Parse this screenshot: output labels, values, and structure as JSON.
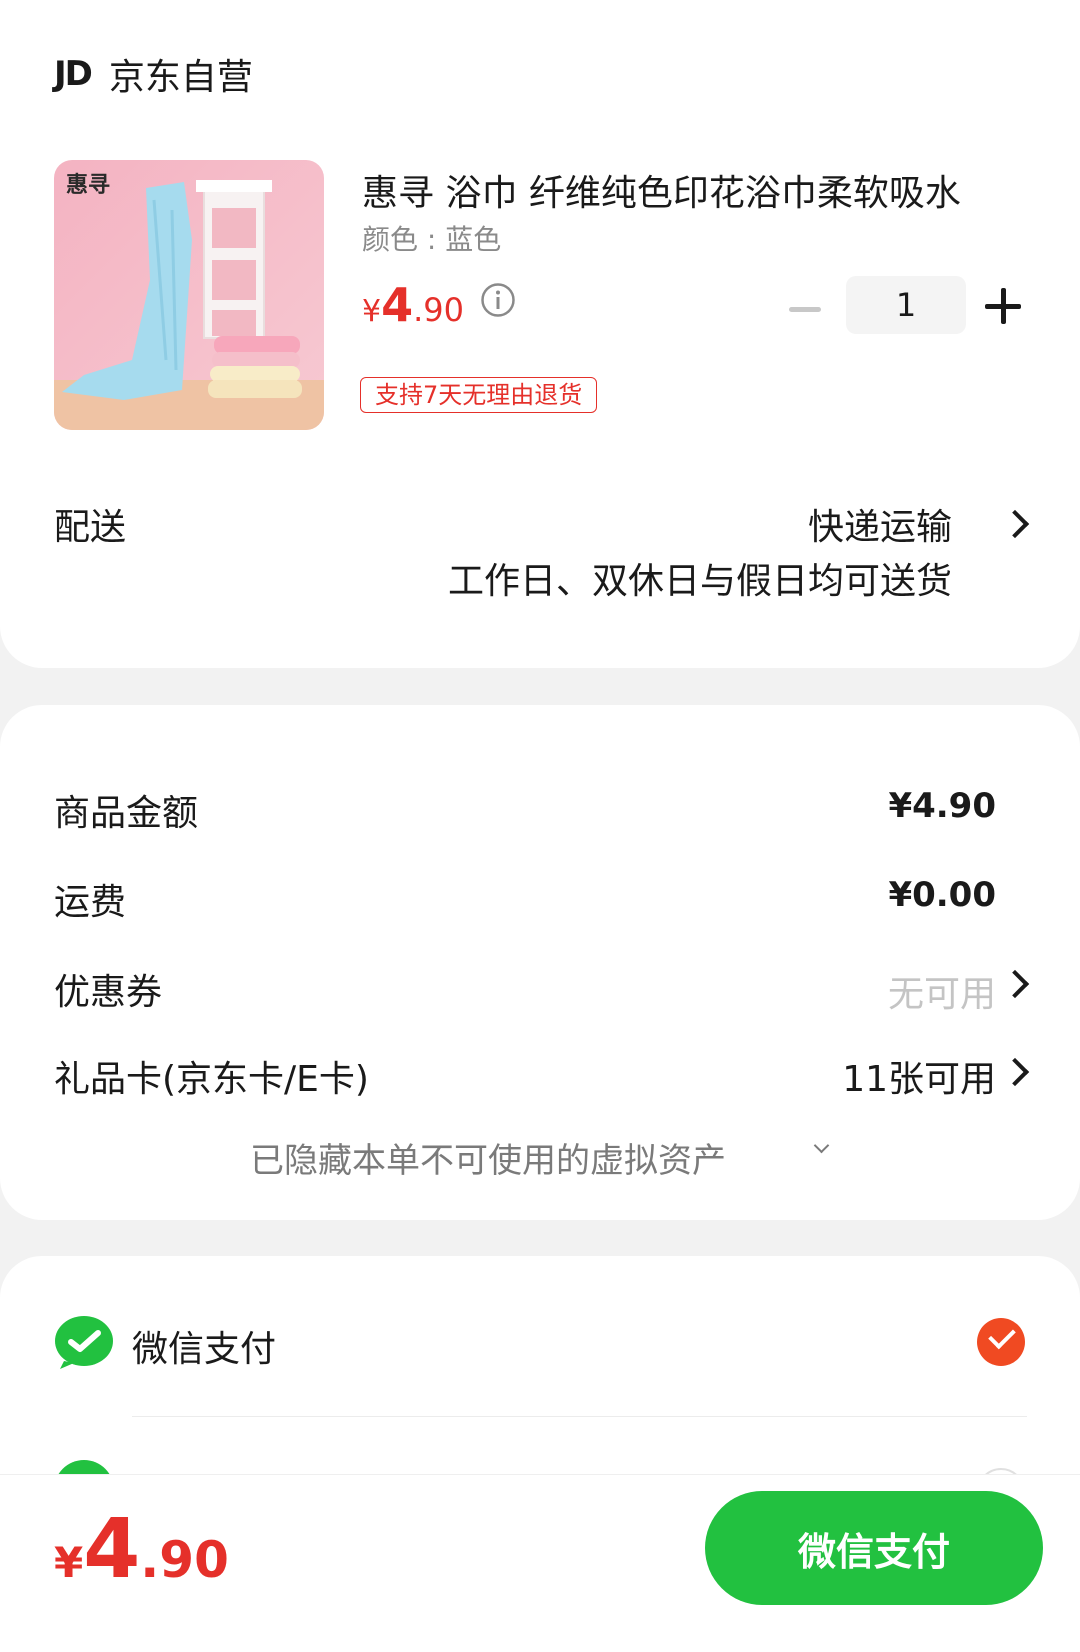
{
  "shop": {
    "logo_text": "JD",
    "name": "京东自营"
  },
  "product": {
    "image_text": "惠寻",
    "title": "惠寻 浴巾 纤维纯色印花浴巾柔软吸水",
    "spec": "颜色 : 蓝色",
    "price_symbol": "¥",
    "price_int": "4",
    "price_dec": ".90",
    "quantity": "1",
    "return_tag": "支持7天无理由退货"
  },
  "delivery": {
    "label": "配送",
    "method": "快递运输",
    "note": "工作日、双休日与假日均可送货"
  },
  "summary": {
    "goods_label": "商品金额",
    "goods_value": "¥4.90",
    "shipping_label": "运费",
    "shipping_value": "¥0.00",
    "coupon_label": "优惠券",
    "coupon_value": "无可用",
    "giftcard_label": "礼品卡(京东卡/E卡)",
    "giftcard_value": "11张可用",
    "hidden_note": "已隐藏本单不可使用的虚拟资产"
  },
  "payment": {
    "method_label": "微信支付",
    "selected": true
  },
  "footer": {
    "total_symbol": "¥",
    "total_int": "4",
    "total_dec": ".90",
    "pay_button": "微信支付"
  },
  "colors": {
    "price_red": "#e5302a",
    "wechat_green": "#22c140",
    "check_orange": "#f04a22"
  }
}
